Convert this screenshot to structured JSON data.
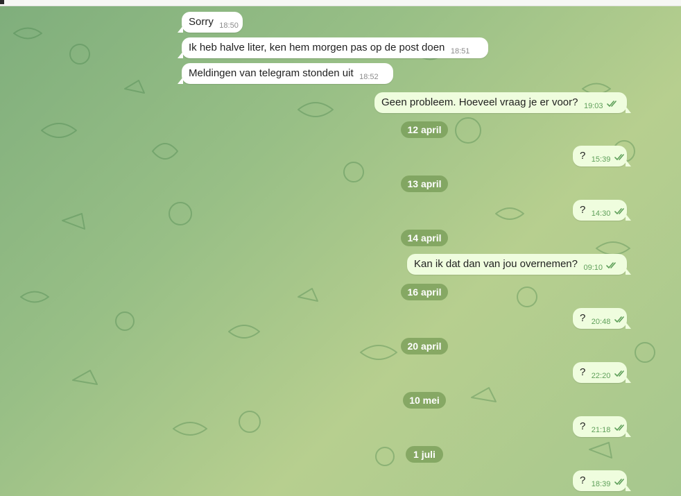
{
  "messages_in": [
    {
      "text": "Sorry",
      "time": "18:50"
    },
    {
      "text": "Ik heb halve liter, ken hem morgen pas op de post doen",
      "time": "18:51"
    },
    {
      "text": "Meldingen van telegram stonden uit",
      "time": "18:52"
    }
  ],
  "messages_out": [
    {
      "text": "Geen probleem. Hoeveel vraag je er voor?",
      "time": "19:03"
    },
    {
      "text": "?",
      "time": "15:39"
    },
    {
      "text": "?",
      "time": "14:30"
    },
    {
      "text": "Kan ik dat dan van jou overnemen?",
      "time": "09:10"
    },
    {
      "text": "?",
      "time": "20:48"
    },
    {
      "text": "?",
      "time": "22:20"
    },
    {
      "text": "?",
      "time": "21:18"
    },
    {
      "text": "?",
      "time": "18:39"
    }
  ],
  "dates": [
    "12 april",
    "13 april",
    "14 april",
    "16 april",
    "20 april",
    "10 mei",
    "1 juli"
  ],
  "icons": {
    "read_receipt": "double-check-icon",
    "background": "cat-doodle-pattern"
  },
  "colors": {
    "incoming_bubble": "#ffffff",
    "outgoing_bubble": "#effdde",
    "time_outgoing": "#5e9f59",
    "date_pill": "#70974f"
  }
}
